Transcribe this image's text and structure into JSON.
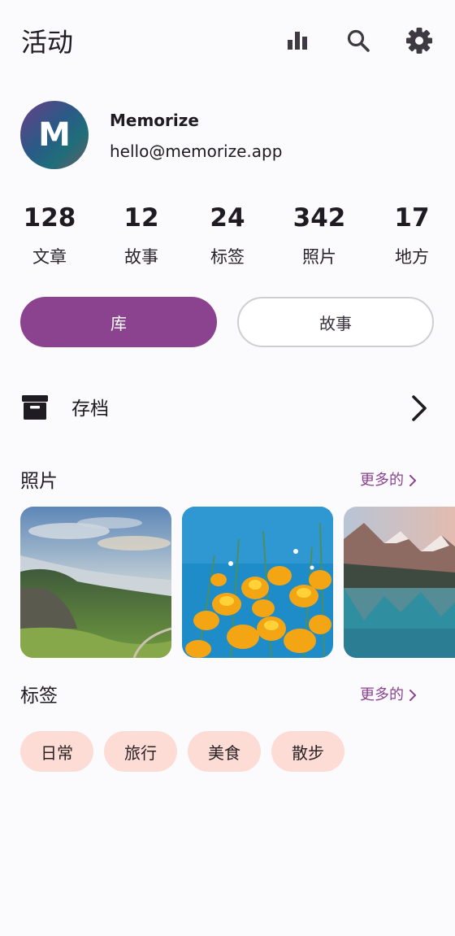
{
  "header": {
    "title": "活动",
    "icons": [
      "bar-chart-icon",
      "search-icon",
      "gear-icon"
    ]
  },
  "profile": {
    "initial": "M",
    "name": "Memorize",
    "email": "hello@memorize.app"
  },
  "stats": [
    {
      "value": "128",
      "label": "文章"
    },
    {
      "value": "12",
      "label": "故事"
    },
    {
      "value": "24",
      "label": "标签"
    },
    {
      "value": "342",
      "label": "照片"
    },
    {
      "value": "17",
      "label": "地方"
    }
  ],
  "toggle": {
    "primary_label": "库",
    "secondary_label": "故事"
  },
  "archive": {
    "label": "存档"
  },
  "photos_section": {
    "title": "照片",
    "more_label": "更多的"
  },
  "tags_section": {
    "title": "标签",
    "more_label": "更多的",
    "tags": [
      "日常",
      "旅行",
      "美食",
      "散步"
    ]
  },
  "colors": {
    "accent": "#8b438f",
    "tag_background": "#fddcd5",
    "background": "#fbfafc"
  }
}
